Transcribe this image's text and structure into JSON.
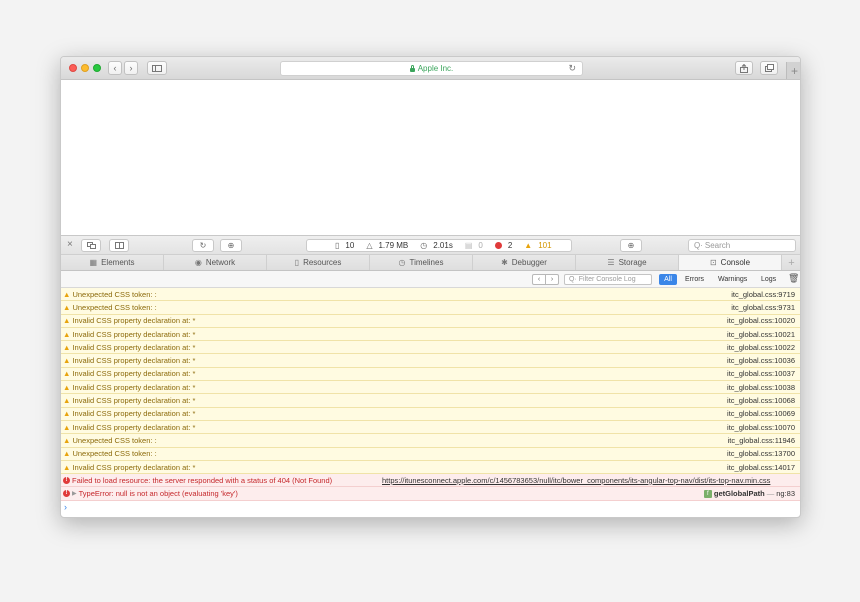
{
  "browser": {
    "address": "Apple Inc.",
    "new_tab": "+"
  },
  "inspector": {
    "close": "×",
    "dashboard": {
      "resources": "10",
      "size": "1.79 MB",
      "time": "2.01s",
      "logs": "0",
      "errors": "2",
      "warnings": "101"
    },
    "search_placeholder": "Search"
  },
  "tabs": [
    {
      "label": "Elements",
      "icon": "▦"
    },
    {
      "label": "Network",
      "icon": "◉"
    },
    {
      "label": "Resources",
      "icon": "▯"
    },
    {
      "label": "Timelines",
      "icon": "◷"
    },
    {
      "label": "Debugger",
      "icon": "✱"
    },
    {
      "label": "Storage",
      "icon": "☰"
    },
    {
      "label": "Console",
      "icon": "⊡"
    }
  ],
  "console": {
    "filter_placeholder": "Filter Console Log",
    "levels": {
      "all": "All",
      "errors": "Errors",
      "warnings": "Warnings",
      "logs": "Logs"
    },
    "warnings": [
      {
        "msg": "Unexpected CSS token: :",
        "src": "itc_global.css:9719"
      },
      {
        "msg": "Unexpected CSS token: :",
        "src": "itc_global.css:9731"
      },
      {
        "msg": "Invalid CSS property declaration at: *",
        "src": "itc_global.css:10020"
      },
      {
        "msg": "Invalid CSS property declaration at: *",
        "src": "itc_global.css:10021"
      },
      {
        "msg": "Invalid CSS property declaration at: *",
        "src": "itc_global.css:10022"
      },
      {
        "msg": "Invalid CSS property declaration at: *",
        "src": "itc_global.css:10036"
      },
      {
        "msg": "Invalid CSS property declaration at: *",
        "src": "itc_global.css:10037"
      },
      {
        "msg": "Invalid CSS property declaration at: *",
        "src": "itc_global.css:10038"
      },
      {
        "msg": "Invalid CSS property declaration at: *",
        "src": "itc_global.css:10068"
      },
      {
        "msg": "Invalid CSS property declaration at: *",
        "src": "itc_global.css:10069"
      },
      {
        "msg": "Invalid CSS property declaration at: *",
        "src": "itc_global.css:10070"
      },
      {
        "msg": "Unexpected CSS token: :",
        "src": "itc_global.css:11946"
      },
      {
        "msg": "Unexpected CSS token: :",
        "src": "itc_global.css:13700"
      },
      {
        "msg": "Invalid CSS property declaration at: *",
        "src": "itc_global.css:14017"
      }
    ],
    "error_resource": {
      "msg": "Failed to load resource: the server responded with a status of 404 (Not Found)",
      "url": "https://itunesconnect.apple.com/c/1456783653/null/itc/bower_components/its-angular-top-nav/dist/its-top-nav.min.css"
    },
    "error_type": {
      "msg": "TypeError: null is not an object (evaluating 'key')",
      "badge": "f",
      "function": "getGlobalPath",
      "sep": "—",
      "location": "ng:83"
    },
    "prompt": "›"
  },
  "colors": {
    "accent": "#3a86e8",
    "warning_bg": "#fffbe1",
    "error_bg": "#fdeded",
    "error": "#e03a3a",
    "warning": "#e8a40d"
  }
}
